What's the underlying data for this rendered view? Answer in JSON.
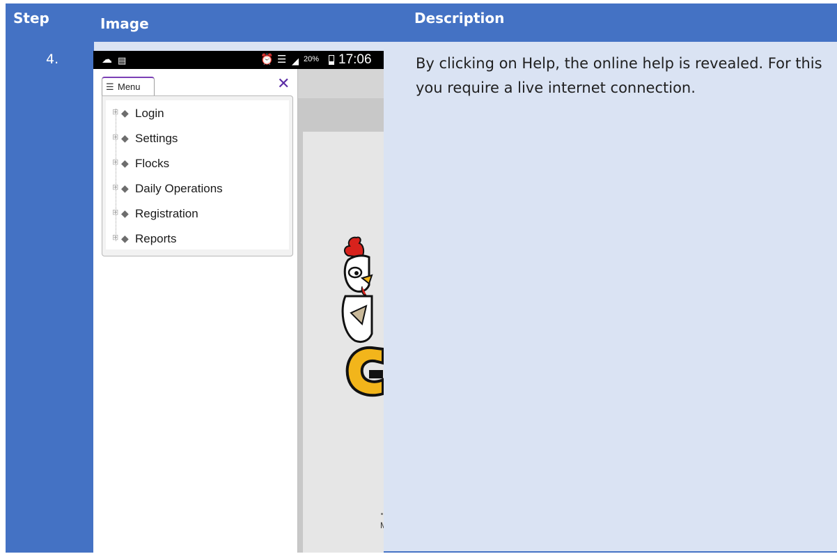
{
  "table": {
    "headers": {
      "step": "Step",
      "image": "Image",
      "description": "Description"
    },
    "row": {
      "step": "4.",
      "description": "By clicking on Help, the online help is revealed. For this you require a live internet connection."
    }
  },
  "phone": {
    "statusbar": {
      "battery": "20%",
      "time": "17:06"
    },
    "menu": {
      "tab_label": "Menu",
      "close_glyph": "✕",
      "items": [
        {
          "label": "Login"
        },
        {
          "label": "Settings"
        },
        {
          "label": "Flocks"
        },
        {
          "label": "Daily Operations"
        },
        {
          "label": "Registration"
        },
        {
          "label": "Reports"
        }
      ]
    },
    "app_partial_text": "M"
  },
  "colors": {
    "header_blue": "#4472c4",
    "row_light_blue": "#dae3f3",
    "menu_accent": "#5b2ba5"
  },
  "icons": [
    "cloud-icon",
    "message-icon",
    "alarm-icon",
    "wifi-icon",
    "signal-icon",
    "battery-icon",
    "list-icon",
    "close-icon",
    "expand-icon",
    "book-icon",
    "chicken-logo"
  ]
}
